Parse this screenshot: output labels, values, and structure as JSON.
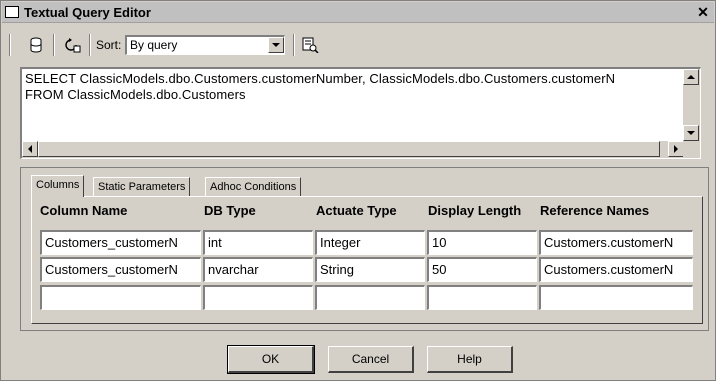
{
  "window": {
    "title": "Textual Query Editor"
  },
  "toolbar": {
    "sort_label": "Sort:",
    "sort_value": "By query",
    "icons": [
      "database-icon",
      "refresh-icon",
      "query-icon"
    ]
  },
  "sql": {
    "lines": [
      "SELECT ClassicModels.dbo.Customers.customerNumber, ClassicModels.dbo.Customers.customerN",
      "FROM ClassicModels.dbo.Customers"
    ]
  },
  "tabs": [
    {
      "label": "Columns",
      "active": true
    },
    {
      "label": "Static Parameters",
      "active": false
    },
    {
      "label": "Adhoc Conditions",
      "active": false
    }
  ],
  "table": {
    "headers": [
      "Column Name",
      "DB Type",
      "Actuate Type",
      "Display Length",
      "Reference Names"
    ],
    "rows": [
      [
        "Customers_customerN",
        "int",
        "Integer",
        "10",
        "Customers.customerN"
      ],
      [
        "Customers_customerN",
        "nvarchar",
        "String",
        "50",
        "Customers.customerN"
      ],
      [
        "",
        "",
        "",
        "",
        ""
      ]
    ]
  },
  "buttons": {
    "ok": "OK",
    "cancel": "Cancel",
    "help": "Help"
  }
}
